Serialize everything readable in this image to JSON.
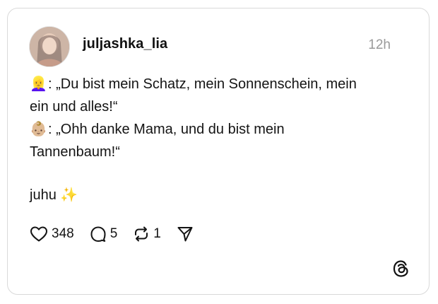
{
  "post": {
    "username": "juljashka_lia",
    "time": "12h",
    "lines": [
      {
        "emoji": "👱‍♀️",
        "text": ": „Du bist mein Schatz, mein Sonnenschein, mein"
      },
      {
        "emoji": "",
        "text": "ein und alles!“"
      },
      {
        "emoji": "👶🏼",
        "text": ": „Ohh danke Mama, und du bist mein"
      },
      {
        "emoji": "",
        "text": "Tannenbaum!“"
      },
      {
        "emoji": "",
        "text": "juhu ✨"
      }
    ]
  },
  "actions": {
    "likes": "348",
    "replies": "5",
    "reposts": "1"
  },
  "icons": {
    "like": "heart-icon",
    "reply": "comment-bubble-icon",
    "repost": "repost-icon",
    "share": "send-icon",
    "brand": "threads-logo-icon"
  }
}
